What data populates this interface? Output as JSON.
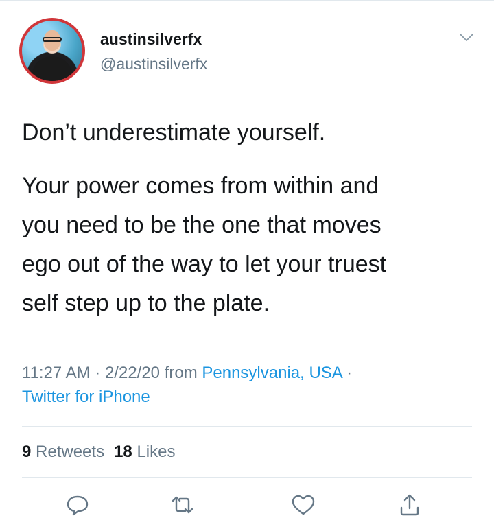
{
  "user": {
    "display_name": "austinsilverfx",
    "handle": "@austinsilverfx"
  },
  "tweet": {
    "lines": [
      "Don’t underestimate yourself.",
      "Your power comes from within and",
      "you need to be the one that moves",
      "ego out of the way to let your truest",
      "self step up to the plate."
    ]
  },
  "meta": {
    "time": "11:27 AM",
    "sep1": " · ",
    "date": "2/22/20",
    "from": " from ",
    "location": "Pennsylvania, USA",
    "sep2": " ·",
    "client": "Twitter for iPhone"
  },
  "stats": {
    "retweets_count": "9",
    "retweets_label": " Retweets",
    "likes_count": "18",
    "likes_label": " Likes"
  },
  "icons": {
    "menu": "chevron-down-icon",
    "reply": "reply-icon",
    "retweet": "retweet-icon",
    "like": "heart-icon",
    "share": "share-icon"
  },
  "colors": {
    "text": "#14171a",
    "secondary": "#657786",
    "link": "#1b95e0",
    "avatar_ring": "#d0363a",
    "divider": "#e1e8ed"
  }
}
